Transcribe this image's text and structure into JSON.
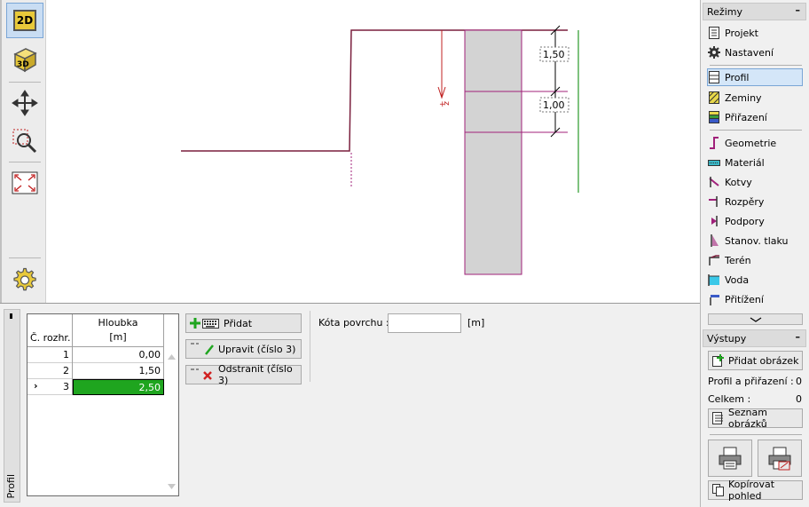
{
  "toolbar": {
    "btn_2d": "2D",
    "btn_3d": "3D"
  },
  "canvas": {
    "dims": [
      "1,50",
      "1,00"
    ],
    "z_label": "z"
  },
  "right_panel": {
    "modes_header": "Režimy",
    "minimize": "–",
    "items": [
      {
        "label": "Projekt",
        "icon": "document-icon"
      },
      {
        "label": "Nastavení",
        "icon": "gear-icon"
      },
      {
        "label": "Profil",
        "icon": "profile-icon"
      },
      {
        "label": "Zeminy",
        "icon": "soil-icon"
      },
      {
        "label": "Přiřazení",
        "icon": "assign-icon"
      },
      {
        "label": "Geometrie",
        "icon": "geometry-icon"
      },
      {
        "label": "Materiál",
        "icon": "material-icon"
      },
      {
        "label": "Kotvy",
        "icon": "anchor-icon"
      },
      {
        "label": "Rozpěry",
        "icon": "strut-icon"
      },
      {
        "label": "Podpory",
        "icon": "support-icon"
      },
      {
        "label": "Stanov. tlaku",
        "icon": "pressure-icon"
      },
      {
        "label": "Terén",
        "icon": "terrain-icon"
      },
      {
        "label": "Voda",
        "icon": "water-icon"
      },
      {
        "label": "Přitížení",
        "icon": "surcharge-icon"
      }
    ],
    "outputs_header": "Výstupy",
    "add_picture": "Přidat obrázek",
    "profile_assign_label": "Profil a přiřazení :",
    "profile_assign_value": "0",
    "total_label": "Celkem :",
    "total_value": "0",
    "picture_list": "Seznam obrázků",
    "copy_view": "Kopírovat pohled"
  },
  "bottom_panel": {
    "side_tab": "Profil",
    "table": {
      "col1_header": "Č. rozhr.",
      "col2_header_line1": "Hloubka",
      "col2_header_line2": "[m]",
      "rows": [
        {
          "num": "1",
          "depth": "0,00"
        },
        {
          "num": "2",
          "depth": "1,50"
        },
        {
          "num": "3",
          "depth": "2,50"
        }
      ],
      "selected_marker": "›"
    },
    "add_button": "Přidat",
    "edit_button": "Upravit (číslo 3)",
    "remove_button": "Odstranit (číslo 3)",
    "surface_label": "Kóta povrchu :",
    "surface_value": "",
    "surface_unit": "[m]"
  },
  "colors": {
    "terrain": "#7a1f3d",
    "wall_fill": "#d3d3d3",
    "wall_border": "#a0207a",
    "green": "#1fa51f",
    "selected_blue": "#d4e6f8"
  }
}
